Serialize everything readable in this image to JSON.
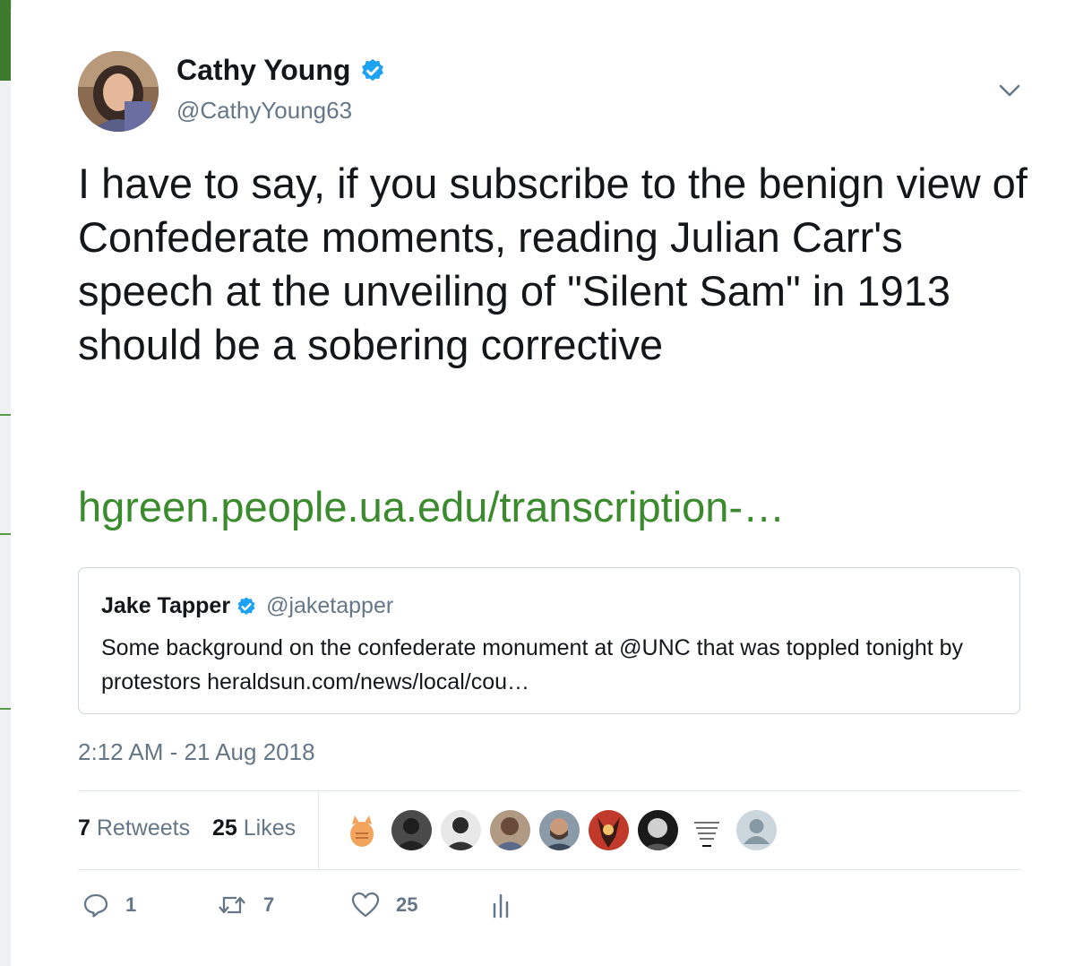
{
  "tweet": {
    "author_name": "Cathy Young",
    "author_handle": "@CathyYoung63",
    "text": "I have to say, if you subscribe to the benign view of Confederate moments, reading Julian Carr's speech at the unveiling of \"Silent Sam\" in 1913 should be a sobering corrective",
    "link_text": "hgreen.people.ua.edu/transcription-…",
    "timestamp": "2:12 AM - 21 Aug 2018"
  },
  "quoted_tweet": {
    "author_name": "Jake Tapper",
    "author_handle": "@jaketapper",
    "text": "Some background on the confederate monument at @UNC that was toppled tonight by protestors heraldsun.com/news/local/cou…"
  },
  "stats": {
    "retweets_count": "7",
    "retweets_label": "Retweets",
    "likes_count": "25",
    "likes_label": "Likes"
  },
  "actions": {
    "reply_count": "1",
    "retweet_count": "7",
    "like_count": "25"
  },
  "colors": {
    "link": "#3b8a2e",
    "verified": "#1da1f2",
    "muted": "#657786"
  },
  "icons": [
    "verified-badge-icon",
    "chevron-down-icon",
    "reply-icon",
    "retweet-icon",
    "heart-icon",
    "analytics-icon"
  ]
}
